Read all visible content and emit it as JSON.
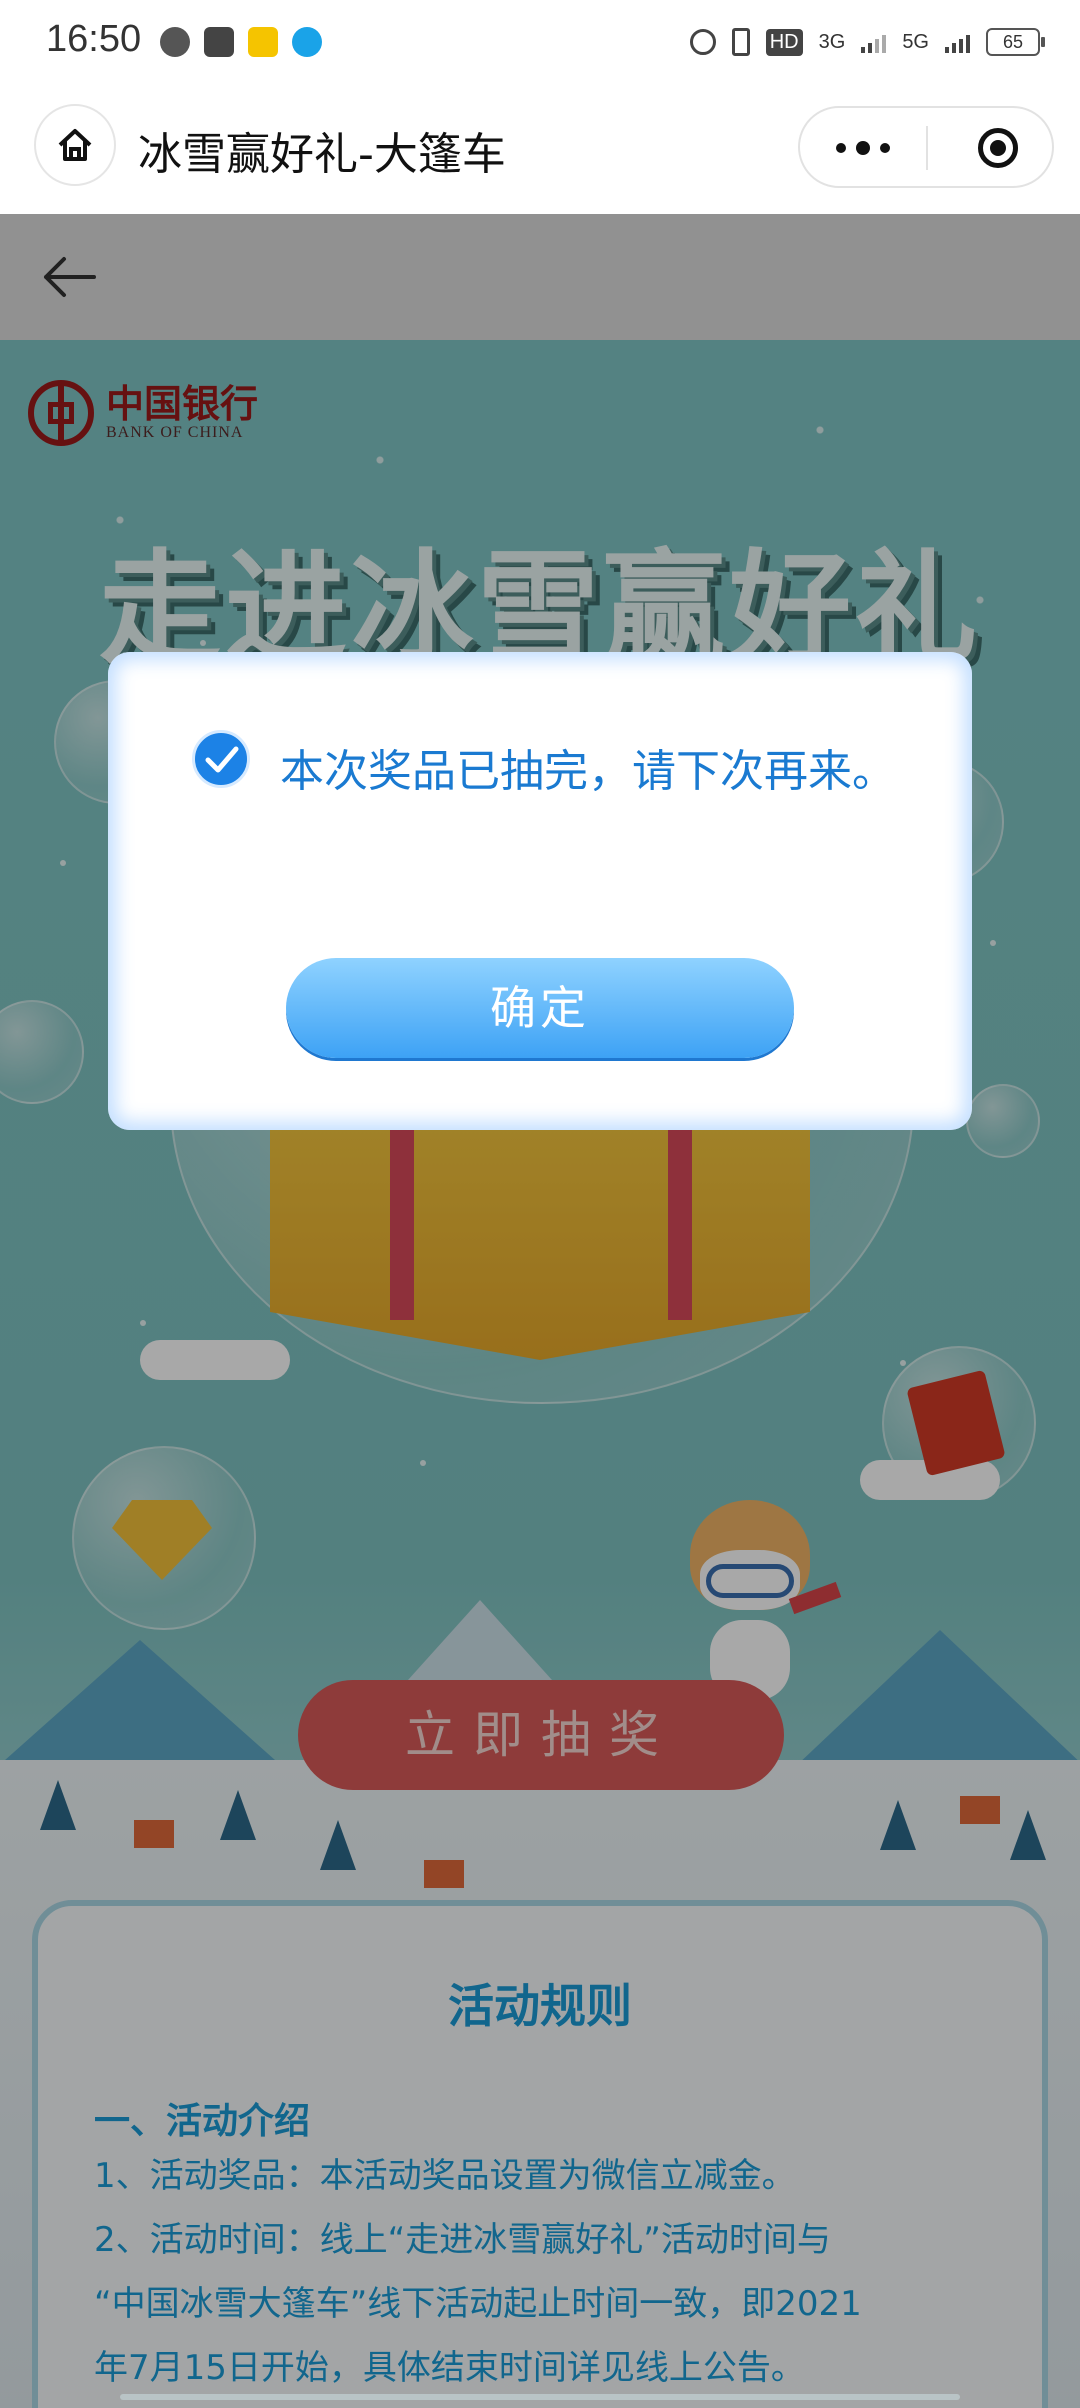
{
  "status_bar": {
    "time": "16:50",
    "battery": "65",
    "network_labels": [
      "HD",
      "3G",
      "5G"
    ],
    "app_icons": [
      "wechat-icon",
      "alipay-icon",
      "app-icon",
      "qq-icon"
    ],
    "indicator_icons": [
      "alarm-icon",
      "vibrate-icon",
      "signal-icon",
      "battery-icon"
    ]
  },
  "title_bar": {
    "title": "冰雪赢好礼-大篷车",
    "home_icon": "home-icon",
    "more_icon": "more-icon",
    "close_icon": "target-icon"
  },
  "page_header": {
    "back_icon": "back-arrow-icon"
  },
  "campaign": {
    "brand_cn": "中国银行",
    "brand_en": "BANK OF CHINA",
    "headline": "走进冰雪赢好礼",
    "draw_button": "立即抽奖",
    "rules": {
      "title": "活动规则",
      "section": "一、活动介绍",
      "lines": [
        "1、活动奖品：本活动奖品设置为微信立减金。",
        "2、活动时间：线上“走进冰雪赢好礼”活动时间与",
        "“中国冰雪大篷车”线下活动起止时间一致，即2021",
        "年7月15日开始，具体结束时间详见线上公告。"
      ]
    }
  },
  "dialog": {
    "message": "本次奖品已抽完，请下次再来。",
    "confirm_label": "确定",
    "icon": "check-circle-icon"
  },
  "colors": {
    "accent": "#1a7ad1",
    "button_blue": "#3da2f5",
    "draw_red": "#d85a58",
    "bg_teal": "#7fc3c1"
  }
}
